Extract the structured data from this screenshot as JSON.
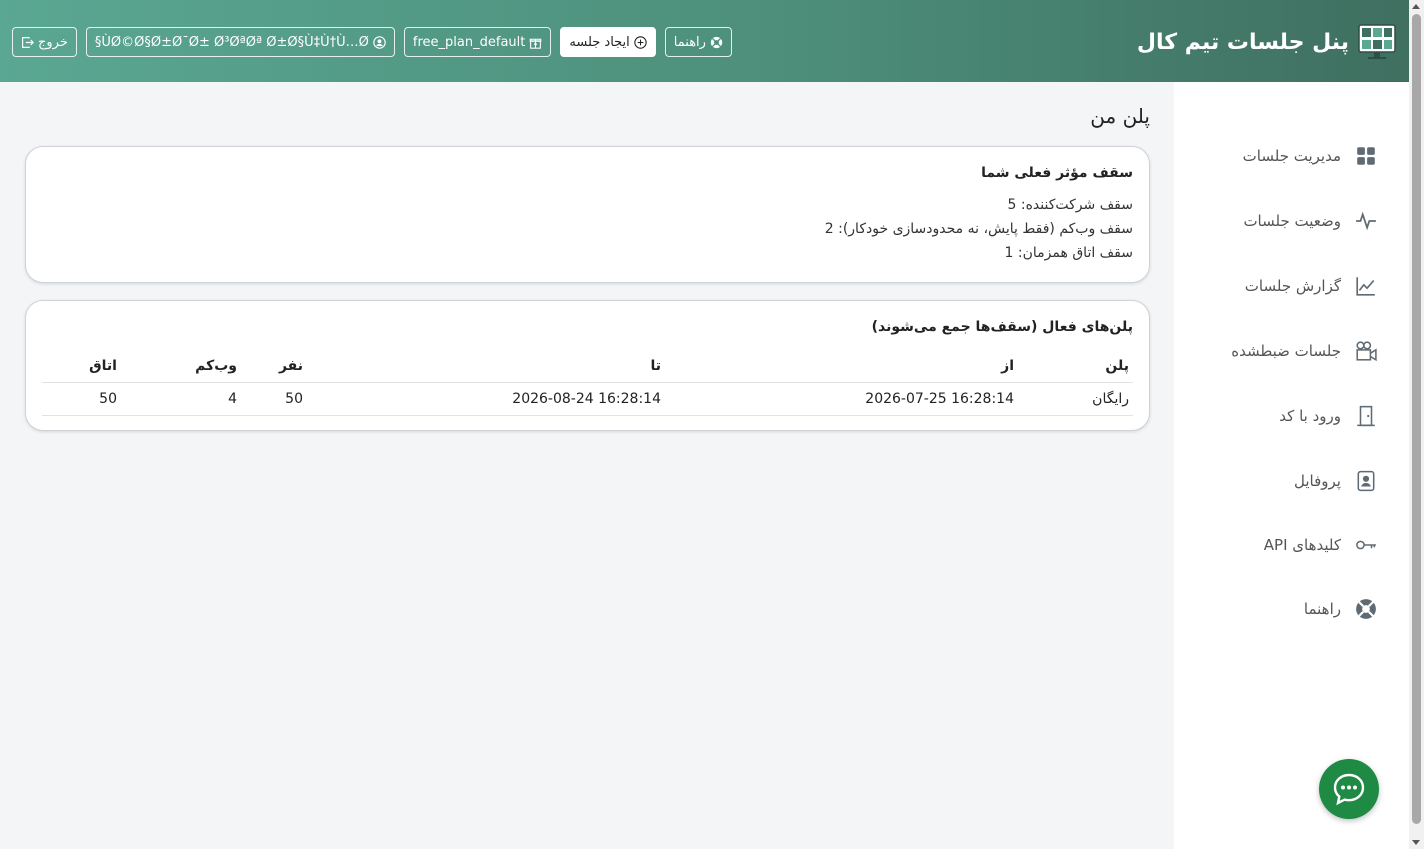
{
  "header": {
    "title": "پنل جلسات تیم کال",
    "buttons": {
      "logout": "خروج",
      "user": "§ÙØ©Ø§Ø±Ø¯Ø± Ø³ØªØª Ø±Ø§Ù‡Ù†Ù…Ø",
      "plan": "free_plan_default",
      "create": "ایجاد جلسه",
      "help": "راهنما"
    }
  },
  "sidebar": {
    "items": [
      {
        "label": "مدیریت جلسات",
        "icon": "grid-icon"
      },
      {
        "label": "وضعیت جلسات",
        "icon": "activity-icon"
      },
      {
        "label": "گزارش جلسات",
        "icon": "chart-icon"
      },
      {
        "label": "جلسات ضبطشده",
        "icon": "video-camera-icon"
      },
      {
        "label": "ورود با کد",
        "icon": "door-icon"
      },
      {
        "label": "پروفایل",
        "icon": "person-badge-icon"
      },
      {
        "label": "کلیدهای API",
        "icon": "key-icon"
      },
      {
        "label": "راهنما",
        "icon": "lifebuoy-icon"
      }
    ]
  },
  "main": {
    "page_title": "پلن من",
    "limits": {
      "title": "سقف مؤثر فعلی شما",
      "participants": "سقف شرکت‌کننده: 5",
      "webcams": "سقف وب‌کم (فقط پایش، نه محدودسازی خودکار): 2",
      "rooms": "سقف اتاق همزمان: 1"
    },
    "plans": {
      "title": "پلن‌های فعال (سقف‌ها جمع می‌شوند)",
      "headers": {
        "plan": "پلن",
        "from": "از",
        "to": "تا",
        "people": "نفر",
        "webcam": "وب‌کم",
        "room": "اتاق"
      },
      "rows": [
        {
          "plan": "رایگان",
          "from": "2026-07-25 16:28:14",
          "to": "2026-08-24 16:28:14",
          "people": "50",
          "webcam": "4",
          "room": "50"
        }
      ]
    }
  },
  "colors": {
    "header_start": "#5aa792",
    "header_end": "#3f6f60",
    "chat": "#1e8a44"
  }
}
